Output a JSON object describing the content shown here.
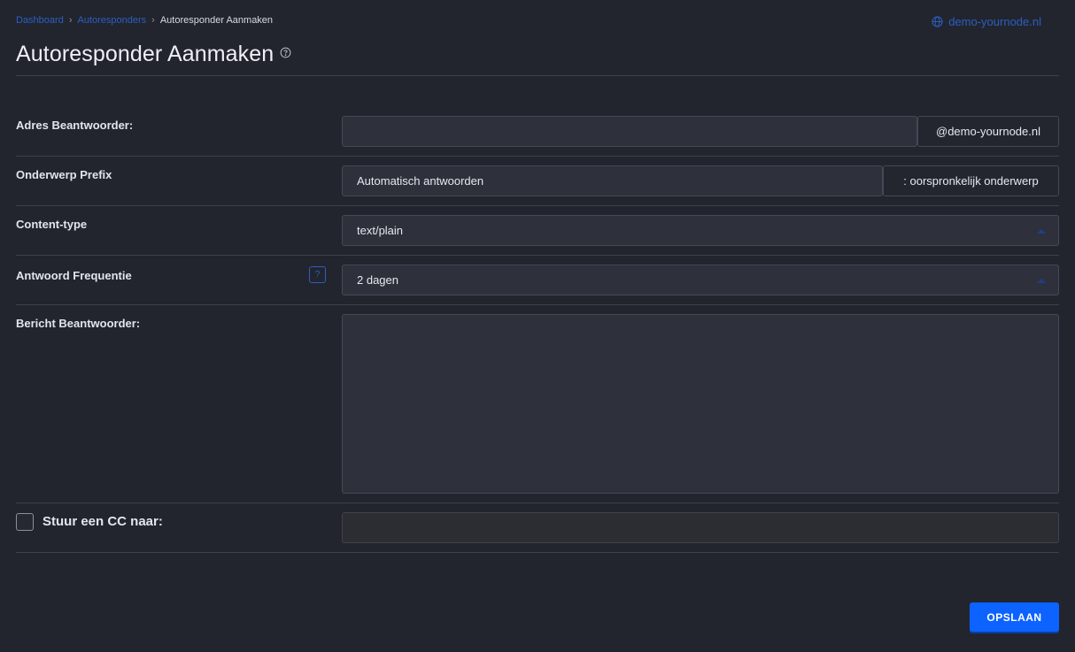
{
  "breadcrumb": {
    "items": [
      "Dashboard",
      "Autoresponders"
    ],
    "current": "Autoresponder Aanmaken"
  },
  "header": {
    "domain": "demo-yournode.nl",
    "title": "Autoresponder Aanmaken"
  },
  "form": {
    "address": {
      "label": "Adres Beantwoorder:",
      "value": "",
      "suffix": "@demo-yournode.nl"
    },
    "subject_prefix": {
      "label": "Onderwerp Prefix",
      "value": "Automatisch antwoorden",
      "suffix": ": oorspronkelijk onderwerp"
    },
    "content_type": {
      "label": "Content-type",
      "selected": "text/plain"
    },
    "frequency": {
      "label": "Antwoord Frequentie",
      "help": "?",
      "selected": "2 dagen"
    },
    "message": {
      "label": "Bericht Beantwoorder:",
      "value": ""
    },
    "cc": {
      "label": "Stuur een CC naar:",
      "checked": false,
      "value": ""
    }
  },
  "actions": {
    "save_label": "OPSLAAN"
  },
  "colors": {
    "background": "#22252e",
    "accent": "#0d63ff",
    "link": "#2b5fc0"
  }
}
